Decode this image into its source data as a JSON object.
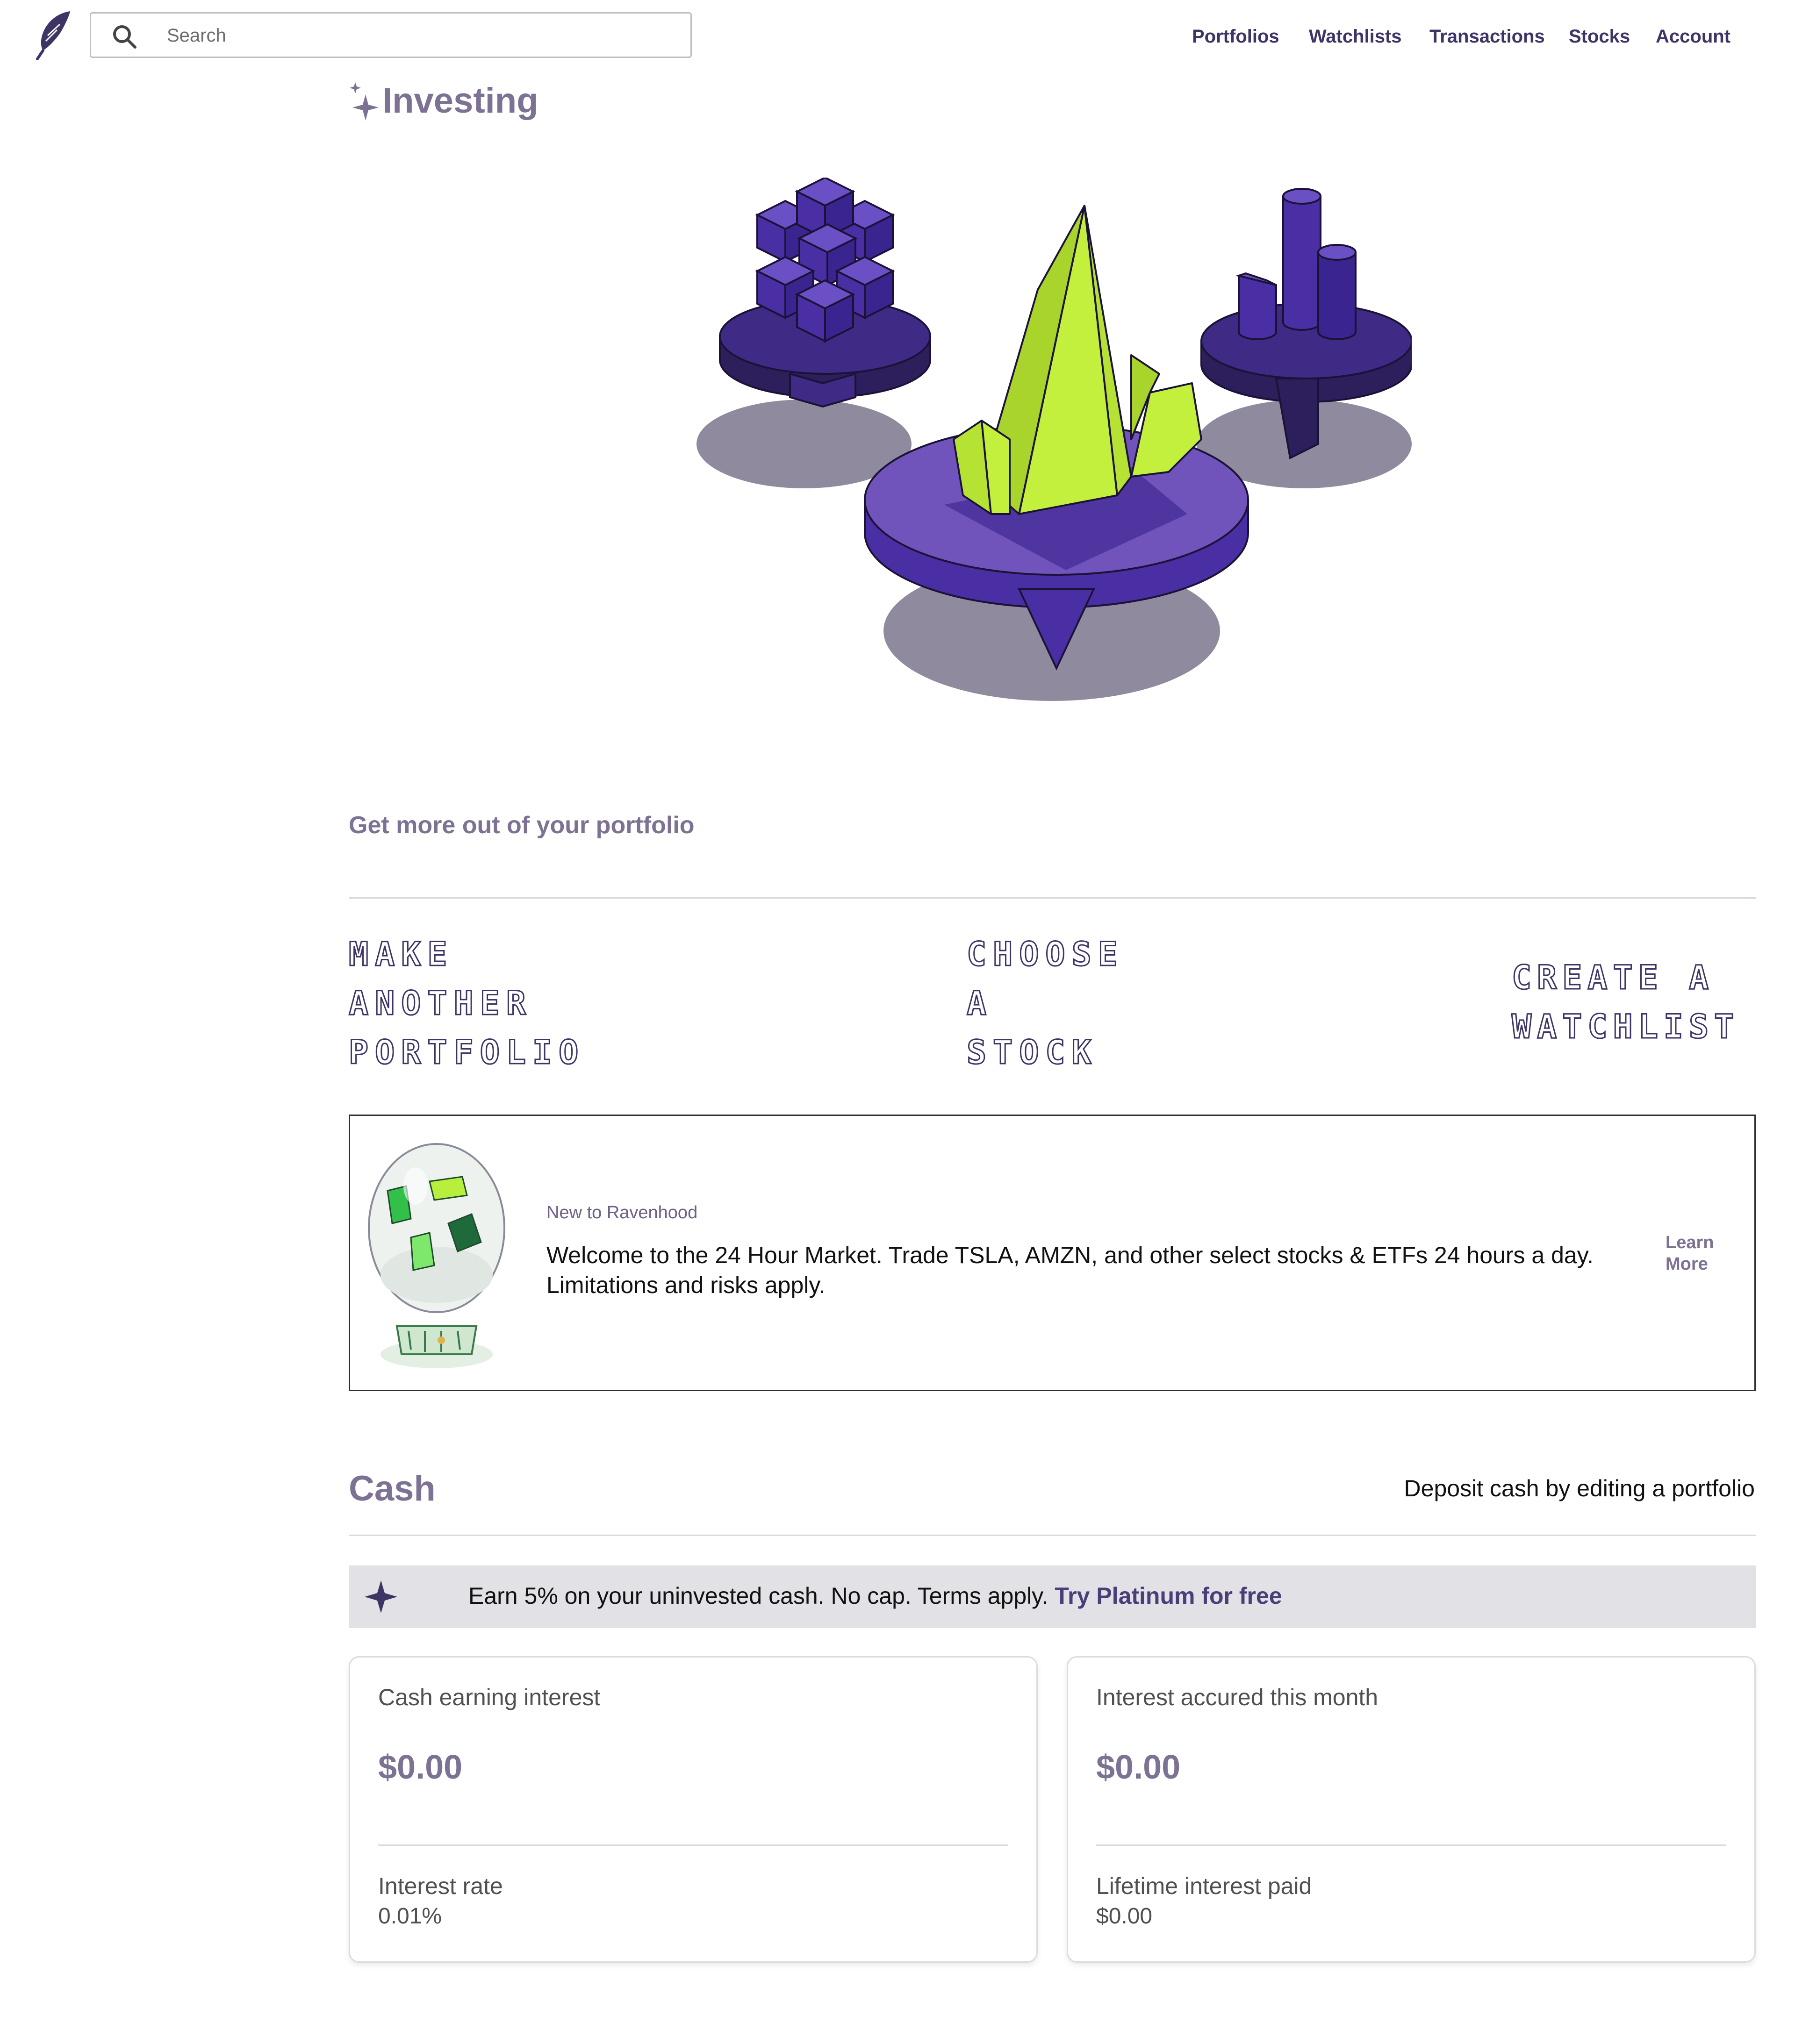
{
  "header": {
    "search_placeholder": "Search",
    "nav": [
      "Portfolios",
      "Watchlists",
      "Transactions",
      "Stocks",
      "Account"
    ]
  },
  "page": {
    "title": "Investing"
  },
  "portfolio": {
    "heading": "Get more out of your portfolio",
    "actions": [
      "MAKE\nANOTHER\nPORTFOLIO",
      "CHOOSE\nA\nSTOCK",
      "CREATE A\nWATCHLIST"
    ]
  },
  "promo": {
    "kicker": "New to Ravenhood",
    "body": "Welcome to the 24 Hour Market. Trade TSLA, AMZN, and other select stocks & ETFs 24 hours a day. Limitations and risks apply.",
    "cta": "Learn More"
  },
  "cash": {
    "heading": "Cash",
    "hint": "Deposit cash by editing a portfolio",
    "banner_text": "Earn 5% on your uninvested cash. No cap. Terms apply.",
    "banner_link": "Try Platinum for free",
    "cards": [
      {
        "label": "Cash earning interest",
        "value": "$0.00",
        "sublabel": "Interest rate",
        "subvalue": "0.01%"
      },
      {
        "label": "Interest accured this month",
        "value": "$0.00",
        "sublabel": "Lifetime interest paid",
        "subvalue": "$0.00"
      }
    ]
  },
  "colors": {
    "brand_purple": "#3f3466",
    "accent_lavender": "#7d7294",
    "lime": "#c3f03c",
    "banner_gray": "#e1e1e6"
  },
  "icons": [
    "feather-logo-icon",
    "search-icon",
    "sparkle-icon"
  ]
}
